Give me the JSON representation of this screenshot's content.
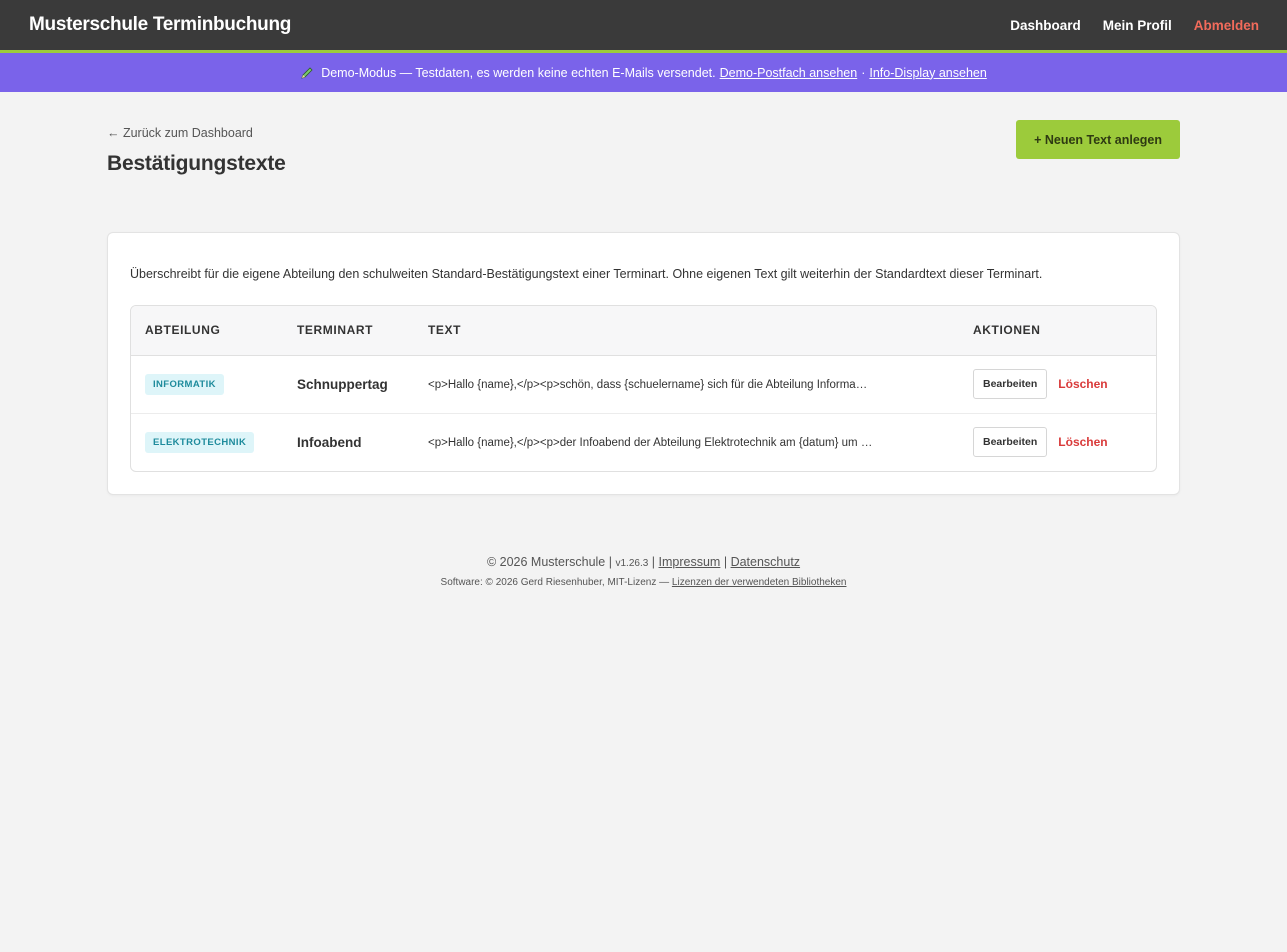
{
  "navbar": {
    "brand": "Musterschule Terminbuchung",
    "links": {
      "dashboard": "Dashboard",
      "profile": "Mein Profil",
      "logout": "Abmelden"
    },
    "colors": {
      "background": "#3a3a3a",
      "accent": "#9ccb3b",
      "logout": "#f26b5b"
    }
  },
  "demo_banner": {
    "icon": "pencil-icon",
    "text": "Demo-Modus — Testdaten, es werden keine echten E-Mails versendet.",
    "link_mailbox": "Demo-Postfach ansehen",
    "separator": "·",
    "link_display": "Info-Display ansehen",
    "color": "#7a63ea"
  },
  "page": {
    "back_link": "← Zurück zum Dashboard",
    "title": "Bestätigungstexte",
    "new_button": "+ Neuen Text anlegen"
  },
  "card": {
    "intro": "Überschreibt für die eigene Abteilung den schulweiten Standard-Bestätigungstext einer Terminart. Ohne eigenen Text gilt weiterhin der Standardtext dieser Terminart.",
    "table": {
      "headers": {
        "abteilung": "ABTEILUNG",
        "terminart": "TERMINART",
        "text": "TEXT",
        "aktionen": "AKTIONEN"
      },
      "rows": [
        {
          "abteilung": "INFORMATIK",
          "terminart": "Schnuppertag",
          "text": "<p>Hallo {name},</p><p>schön, dass {schuelername} sich für die Abteilung Informa…",
          "edit": "Bearbeiten",
          "delete": "Löschen"
        },
        {
          "abteilung": "ELEKTROTECHNIK",
          "terminart": "Infoabend",
          "text": "<p>Hallo {name},</p><p>der Infoabend der Abteilung Elektrotechnik am {datum} um …",
          "edit": "Bearbeiten",
          "delete": "Löschen"
        }
      ]
    }
  },
  "footer": {
    "copyright": "© 2026 Musterschule",
    "sep1": "|",
    "version": "v1.26.3",
    "sep2": "|",
    "imprint": "Impressum",
    "sep3": "|",
    "privacy": "Datenschutz",
    "software": "Software: © 2026 Gerd Riesenhuber, MIT-Lizenz —",
    "licenses": "Lizenzen der verwendeten Bibliotheken"
  }
}
